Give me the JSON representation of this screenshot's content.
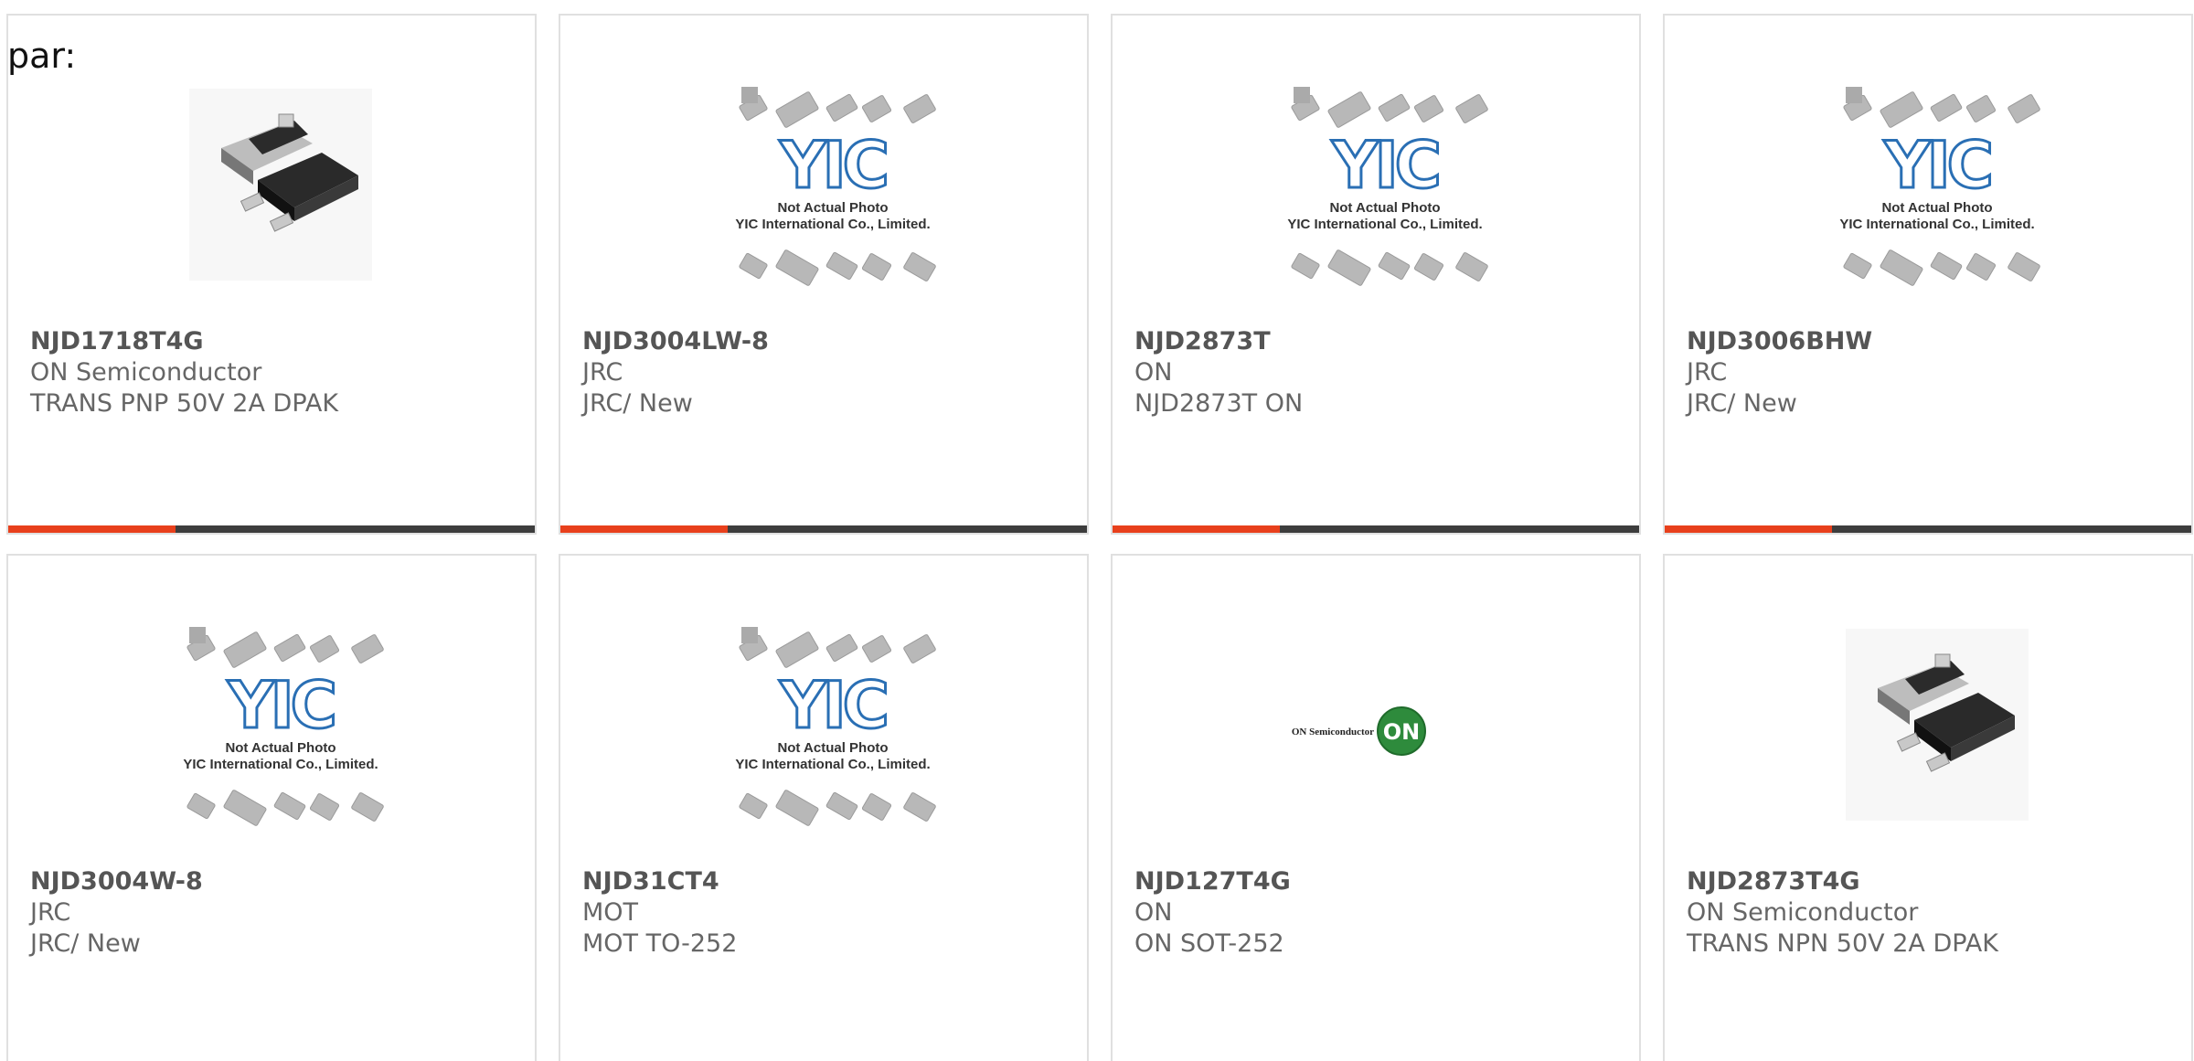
{
  "prefix_text": "par:",
  "accent_color": "#e8401c",
  "bar_color": "#3d3d3d",
  "products": [
    {
      "part": "NJD1718T4G",
      "maker": "ON Semiconductor",
      "desc": "TRANS PNP 50V 2A DPAK",
      "image": "dpak-package-photo"
    },
    {
      "part": "NJD3004LW-8",
      "maker": "JRC",
      "desc": "JRC/ New",
      "image": "yic-placeholder"
    },
    {
      "part": "NJD2873T",
      "maker": "ON",
      "desc": "NJD2873T ON",
      "image": "yic-placeholder"
    },
    {
      "part": "NJD3006BHW",
      "maker": "JRC",
      "desc": "JRC/ New",
      "image": "yic-placeholder"
    },
    {
      "part": "NJD3004W-8",
      "maker": "JRC",
      "desc": "JRC/ New",
      "image": "yic-placeholder"
    },
    {
      "part": "NJD31CT4",
      "maker": "MOT",
      "desc": "MOT TO-252",
      "image": "yic-placeholder"
    },
    {
      "part": "NJD127T4G",
      "maker": "ON",
      "desc": "ON SOT-252",
      "image": "on-semi-logo"
    },
    {
      "part": "NJD2873T4G",
      "maker": "ON Semiconductor",
      "desc": "TRANS NPN 50V 2A DPAK",
      "image": "dpak-package-photo"
    }
  ],
  "placeholder": {
    "line1": "Not Actual Photo",
    "line2": "YIC International Co., Limited.",
    "logo": "YIC"
  },
  "on_logo": {
    "wordmark": "ON Semiconductor",
    "badge": "ON"
  }
}
